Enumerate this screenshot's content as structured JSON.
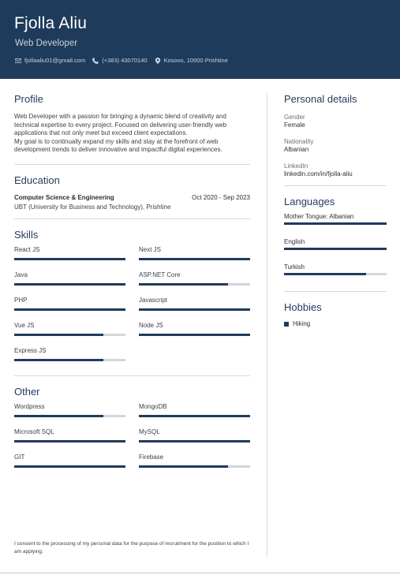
{
  "header": {
    "name": "Fjolla Aliu",
    "title": "Web Developer",
    "email": "fjollaaliu01@gmail.com",
    "phone": "(+383) 43070140",
    "location": "Kosovo, 10000 Prishtine"
  },
  "profile": {
    "heading": "Profile",
    "p1": "Web Developer with a passion for bringing a dynamic blend of creativity and technical expertise to every project. Focused on delivering user-friendly web applications that not only meet but exceed client expectations.",
    "p2": "My goal is to continually expand my skills and stay at the forefront of web development trends to deliver innovative and impactful digital experiences."
  },
  "education": {
    "heading": "Education",
    "degree": "Computer Science & Engineering",
    "dates": "Oct 2020 - Sep 2023",
    "school": "UBT (University for Business and Technology), Prishtine"
  },
  "skills": {
    "heading": "Skills",
    "items": [
      {
        "label": "React JS",
        "level": 1.0
      },
      {
        "label": "Next JS",
        "level": 1.0
      },
      {
        "label": "Java",
        "level": 1.0
      },
      {
        "label": "ASP.NET Core",
        "level": 0.8
      },
      {
        "label": "PHP",
        "level": 1.0
      },
      {
        "label": "Javascript",
        "level": 1.0
      },
      {
        "label": "Vue JS",
        "level": 0.8
      },
      {
        "label": "Node JS",
        "level": 1.0
      },
      {
        "label": "Express JS",
        "level": 0.8
      }
    ]
  },
  "other": {
    "heading": "Other",
    "items": [
      {
        "label": "Wordpress",
        "level": 0.8
      },
      {
        "label": "MongoDB",
        "level": 1.0
      },
      {
        "label": "Microsoft SQL",
        "level": 1.0
      },
      {
        "label": "MySQL",
        "level": 1.0
      },
      {
        "label": "GIT",
        "level": 1.0
      },
      {
        "label": "Firebase",
        "level": 0.8
      }
    ]
  },
  "personal": {
    "heading": "Personal details",
    "gender_label": "Gender",
    "gender": "Female",
    "nationality_label": "Nationality",
    "nationality": "Albanian",
    "linkedin_label": "LinkedIn",
    "linkedin": "linkedin.com/in/fjolla-aliu"
  },
  "languages": {
    "heading": "Languages",
    "items": [
      {
        "label": "Mother Tongue: Albanian",
        "level": 1.0
      },
      {
        "label": "English",
        "level": 1.0
      },
      {
        "label": "Turkish",
        "level": 0.8
      }
    ]
  },
  "hobbies": {
    "heading": "Hobbies",
    "items": [
      "Hiking"
    ]
  },
  "consent": "I consent to the processing of my personal data for the purpose of recruitment for the position to which I am applying.",
  "colors": {
    "accent": "#1f3b5c",
    "track": "#d3d6db"
  },
  "icons": [
    "email-icon",
    "phone-icon",
    "location-icon"
  ]
}
